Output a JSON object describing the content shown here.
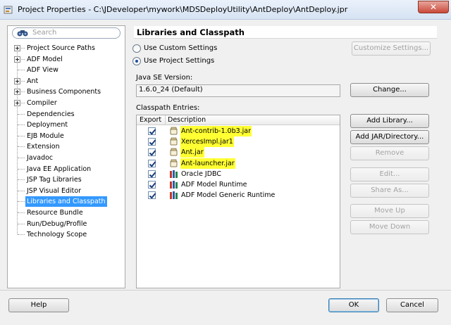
{
  "window": {
    "title": "Project Properties - C:\\JDeveloper\\mywork\\MDSDeployUtility\\AntDeploy\\AntDeploy.jpr",
    "close_glyph": "✕"
  },
  "search": {
    "placeholder": "Search",
    "icon": "binoculars-icon"
  },
  "nav": {
    "items": [
      {
        "label": "Project Source Paths",
        "expandable": true
      },
      {
        "label": "ADF Model",
        "expandable": true
      },
      {
        "label": "ADF View",
        "expandable": false
      },
      {
        "label": "Ant",
        "expandable": true
      },
      {
        "label": "Business Components",
        "expandable": true
      },
      {
        "label": "Compiler",
        "expandable": true
      },
      {
        "label": "Dependencies",
        "expandable": false
      },
      {
        "label": "Deployment",
        "expandable": false
      },
      {
        "label": "EJB Module",
        "expandable": false
      },
      {
        "label": "Extension",
        "expandable": false
      },
      {
        "label": "Javadoc",
        "expandable": false
      },
      {
        "label": "Java EE Application",
        "expandable": false
      },
      {
        "label": "JSP Tag Libraries",
        "expandable": false
      },
      {
        "label": "JSP Visual Editor",
        "expandable": false
      },
      {
        "label": "Libraries and Classpath",
        "expandable": false,
        "selected": true
      },
      {
        "label": "Resource Bundle",
        "expandable": false
      },
      {
        "label": "Run/Debug/Profile",
        "expandable": false
      },
      {
        "label": "Technology Scope",
        "expandable": false
      }
    ]
  },
  "panel": {
    "heading": "Libraries and Classpath",
    "use_custom": "Use Custom Settings",
    "use_project": "Use Project Settings",
    "selected_setting": "project",
    "customize_btn": "Customize Settings...",
    "jse_label": "Java SE Version:",
    "jse_value": "1.6.0_24 (Default)",
    "change_btn": "Change...",
    "classpath_label": "Classpath Entries:",
    "col_export": "Export",
    "col_description": "Description",
    "entries": [
      {
        "name": "Ant-contrib-1.0b3.jar",
        "exported": true,
        "icon": "jar-icon",
        "highlighted": true
      },
      {
        "name": "XercesImpl.jar1",
        "exported": true,
        "icon": "jar-icon",
        "highlighted": true
      },
      {
        "name": "Ant.jar",
        "exported": true,
        "icon": "jar-icon",
        "highlighted": true
      },
      {
        "name": "Ant-launcher.jar",
        "exported": true,
        "icon": "jar-icon",
        "highlighted": true
      },
      {
        "name": "Oracle JDBC",
        "exported": true,
        "icon": "library-icon",
        "highlighted": false
      },
      {
        "name": "ADF Model Runtime",
        "exported": true,
        "icon": "library-icon",
        "highlighted": false
      },
      {
        "name": "ADF Model Generic Runtime",
        "exported": true,
        "icon": "library-icon",
        "highlighted": false
      }
    ],
    "buttons": {
      "add_library": "Add Library...",
      "add_jar": "Add JAR/Directory...",
      "remove": "Remove",
      "edit": "Edit...",
      "share_as": "Share As...",
      "move_up": "Move Up",
      "move_down": "Move Down"
    }
  },
  "footer": {
    "help": "Help",
    "ok": "OK",
    "cancel": "Cancel"
  },
  "colors": {
    "selection": "#3399ff",
    "highlight": "#ffff33",
    "close": "#c94a3a"
  }
}
